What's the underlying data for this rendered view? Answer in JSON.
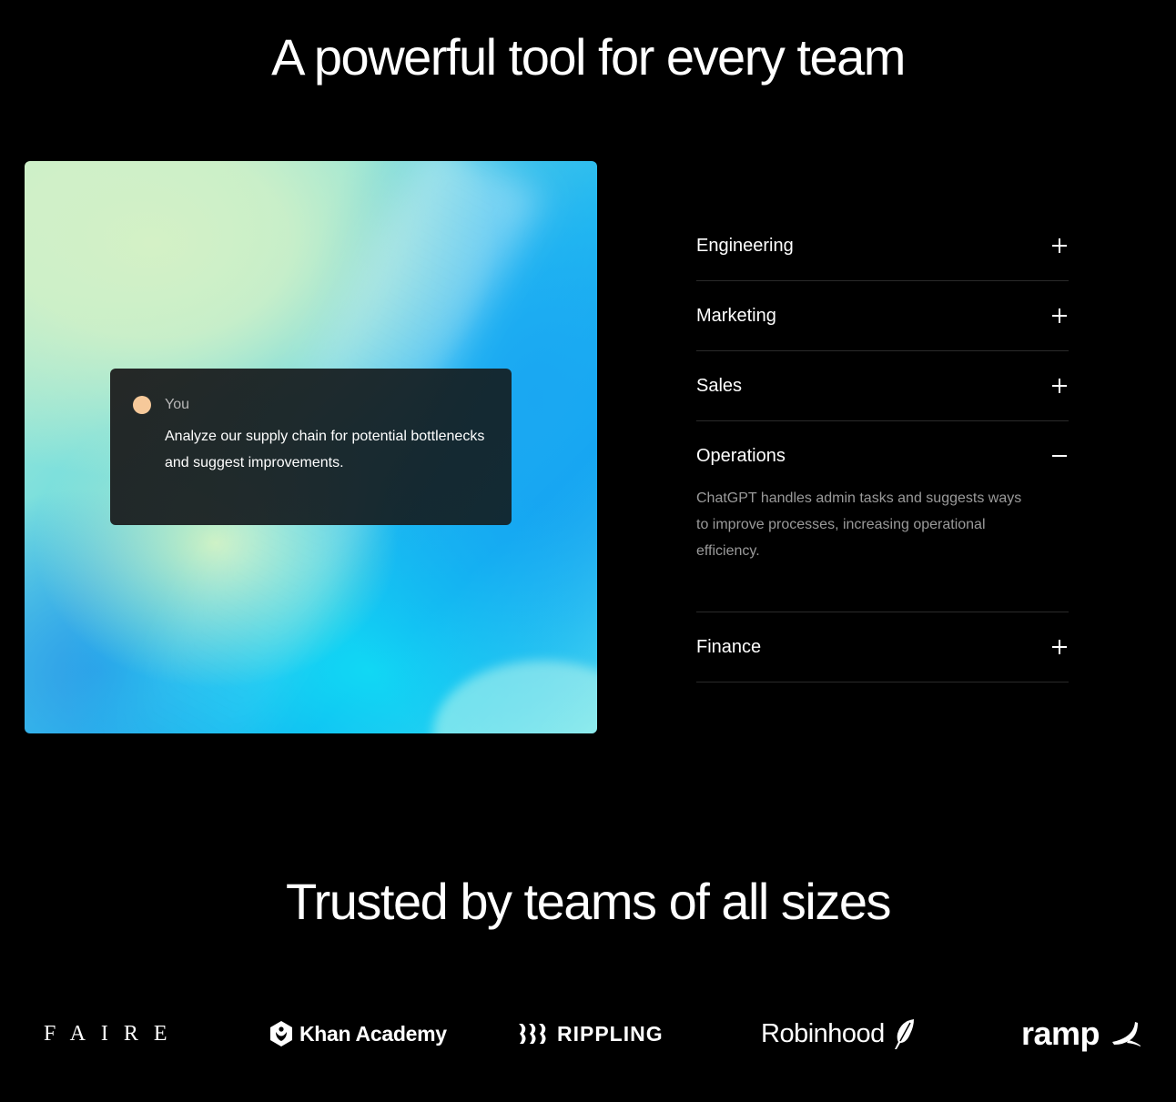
{
  "headline": "A powerful tool for every team",
  "chat": {
    "sender": "You",
    "message": "Analyze our supply chain for potential bottlenecks and suggest improvements.",
    "avatar_color": "#f6c99a"
  },
  "accordion": [
    {
      "label": "Engineering",
      "expanded": false
    },
    {
      "label": "Marketing",
      "expanded": false
    },
    {
      "label": "Sales",
      "expanded": false
    },
    {
      "label": "Operations",
      "expanded": true,
      "body": "ChatGPT handles admin tasks and suggests ways to improve processes, increasing operational efficiency."
    },
    {
      "label": "Finance",
      "expanded": false
    }
  ],
  "trusted_heading": "Trusted by teams of all sizes",
  "logos": {
    "faire": "FAIRE",
    "khan": "Khan Academy",
    "rippling": "RIPPLING",
    "robinhood": "Robinhood",
    "ramp": "ramp"
  }
}
